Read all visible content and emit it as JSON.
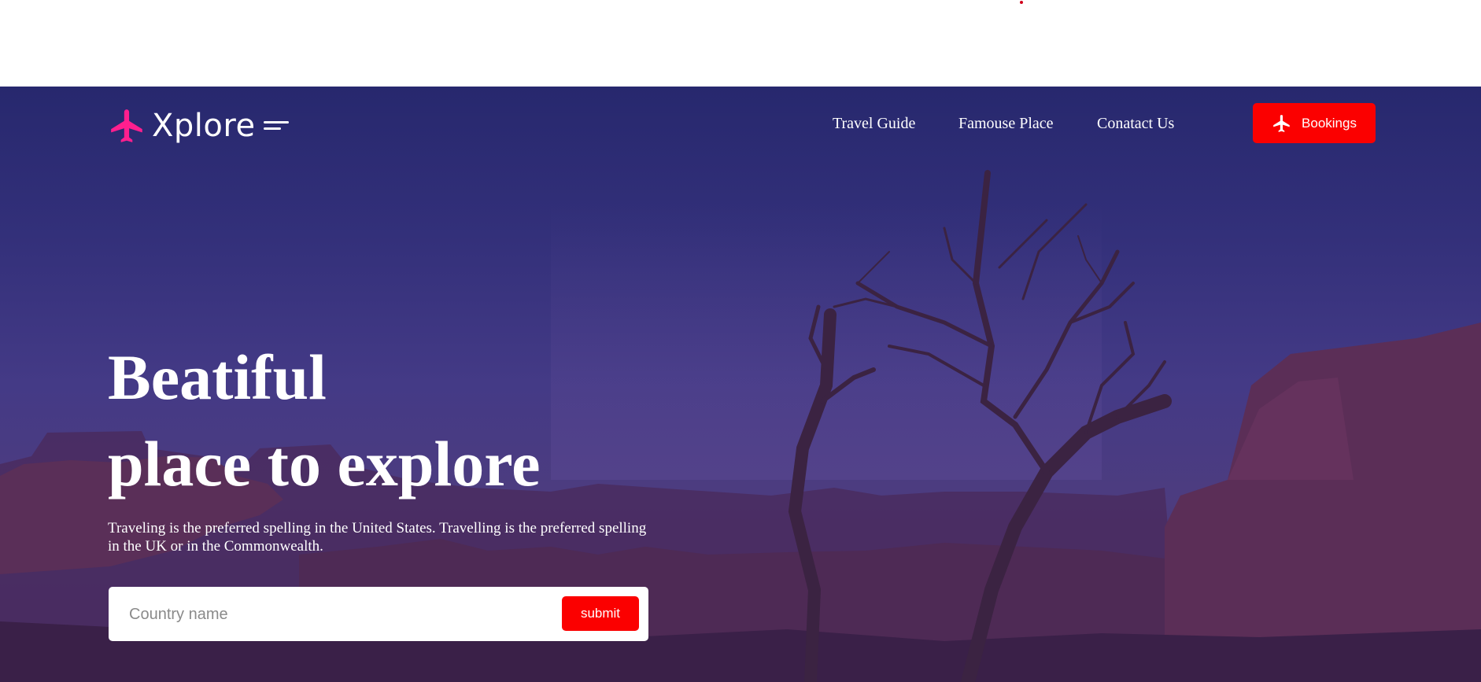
{
  "brand": {
    "name": "Xplore",
    "accent": "#ff1f8e"
  },
  "nav": {
    "items": [
      {
        "label": "Travel Guide"
      },
      {
        "label": "Famouse Place"
      },
      {
        "label": "Conatact Us"
      }
    ],
    "booking_label": "Bookings"
  },
  "hero": {
    "headline_line1": "Beatiful",
    "headline_line2": "place to explore",
    "description": "Traveling is the preferred spelling in the United States. Travelling is the preferred spelling in the UK or in the Commonwealth.",
    "search": {
      "placeholder": "Country name",
      "submit_label": "submit"
    }
  },
  "icons": {
    "logo": "airplane-icon",
    "menu": "menu-lines-icon",
    "booking": "airplane-icon"
  },
  "colors": {
    "primary_button": "#fb0000",
    "hero_tint": "#33307a",
    "text": "#ffffff"
  }
}
